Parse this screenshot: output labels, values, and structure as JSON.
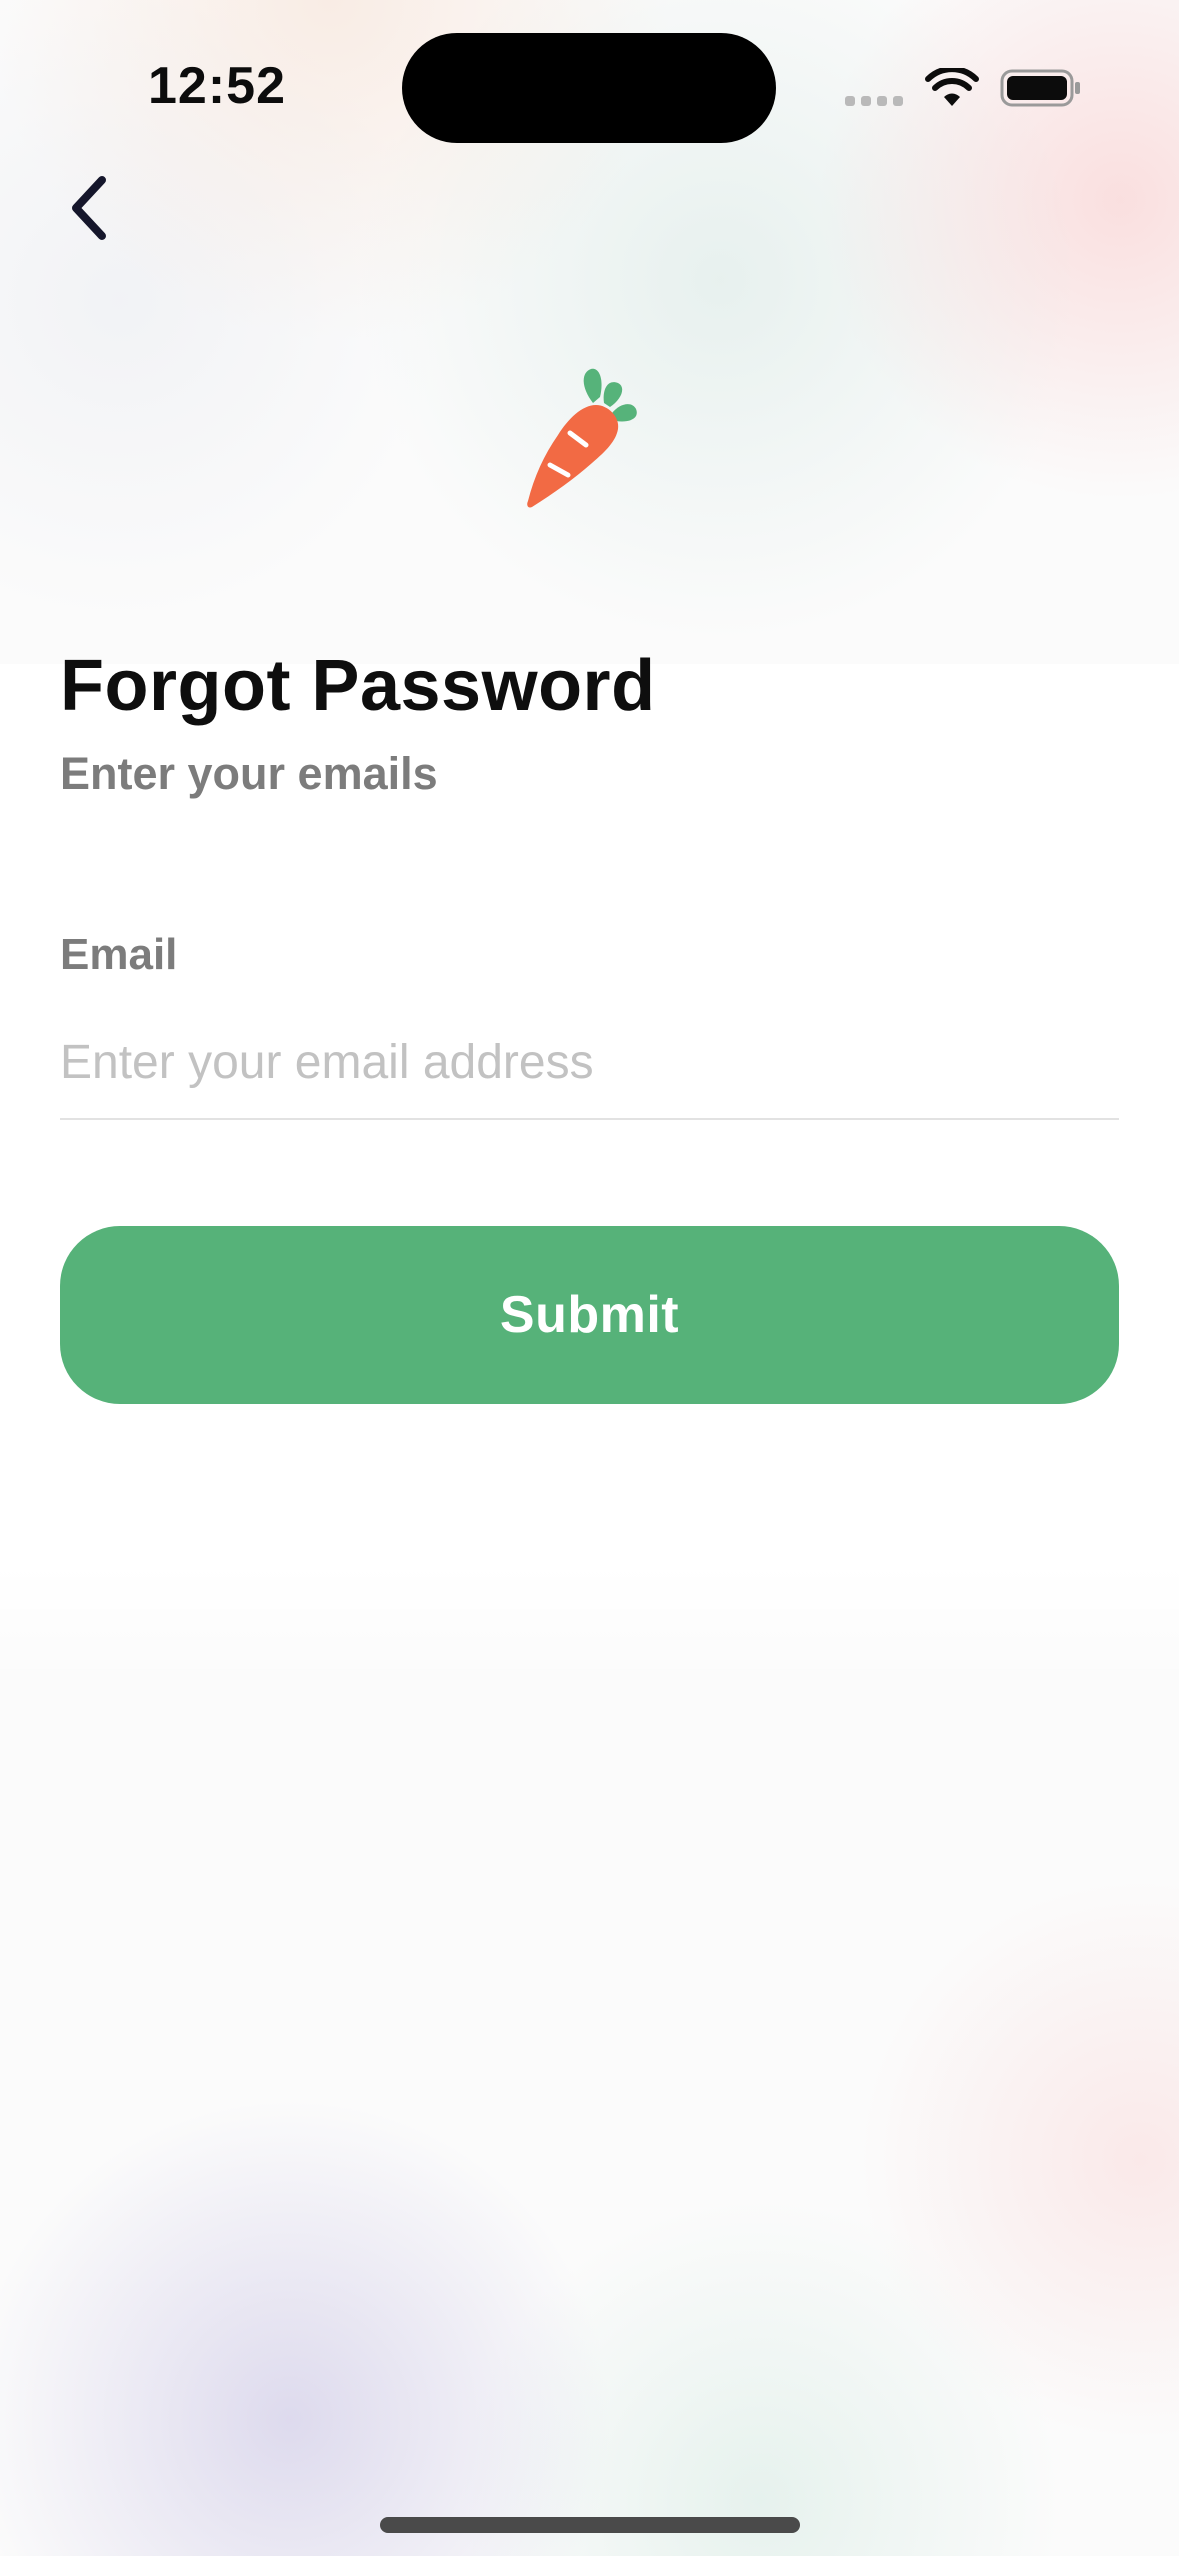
{
  "status_bar": {
    "time": "12:52",
    "icons": [
      "signal-dots-icon",
      "wifi-icon",
      "battery-icon"
    ]
  },
  "navigation": {
    "back_icon": "chevron-left-icon"
  },
  "brand": {
    "logo_icon": "carrot-icon",
    "logo_colors": {
      "body": "#F26A44",
      "leaves": "#56B37A"
    }
  },
  "screen": {
    "title": "Forgot Password",
    "subtitle": "Enter your emails"
  },
  "form": {
    "email_label": "Email",
    "email_value": "",
    "email_placeholder": "Enter your email address",
    "submit_label": "Submit"
  },
  "colors": {
    "accent": "#56B279",
    "title_text": "#0E0E0E",
    "secondary_text": "#7C7C7C",
    "placeholder_text": "#C2C2C2",
    "divider": "#E2E2E2"
  }
}
